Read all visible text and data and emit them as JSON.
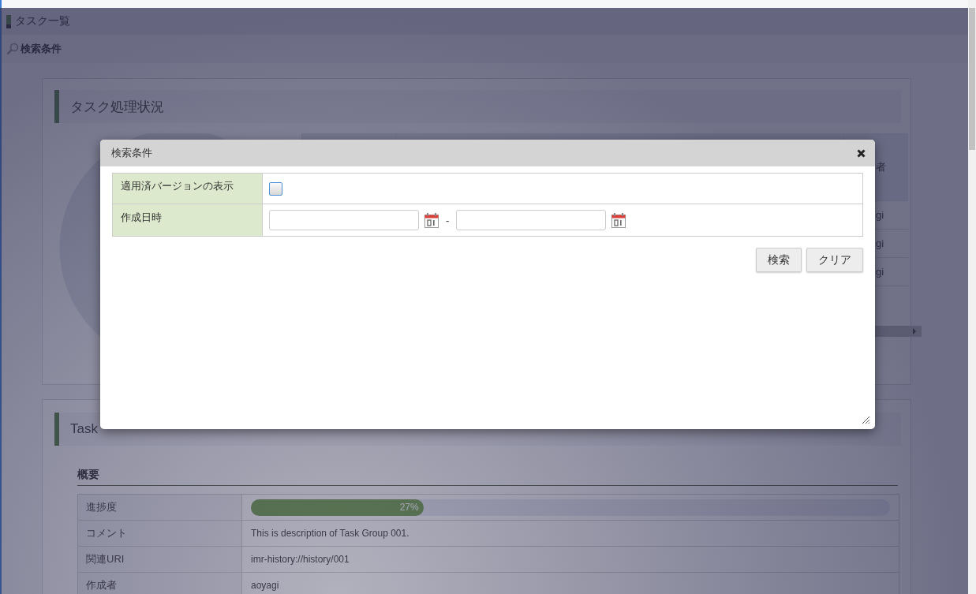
{
  "header": {
    "title": "タスク一覧"
  },
  "search_bar": {
    "label": "検索条件"
  },
  "status_panel": {
    "title": "タスク処理状況",
    "table": {
      "columns": [
        "者"
      ],
      "rows": [
        [
          "gi"
        ],
        [
          "gi"
        ],
        [
          "gi"
        ]
      ]
    }
  },
  "task_group": {
    "title": "Task",
    "section": "概要",
    "rows": [
      {
        "kind": "progress",
        "label": "進捗度",
        "level": 0.27,
        "reading": "27%"
      },
      {
        "kind": "text",
        "label": "コメント",
        "value": "This is description of Task Group 001."
      },
      {
        "kind": "text",
        "label": "関連URI",
        "value": "imr-history://history/001"
      },
      {
        "kind": "text",
        "label": "作成者",
        "value": "aoyagi"
      }
    ]
  },
  "dialog": {
    "title": "検索条件",
    "rows": [
      {
        "kind": "checkbox",
        "label": "適用済バージョンの表示",
        "checked": false
      },
      {
        "kind": "date_range",
        "label": "作成日時",
        "separator": "-"
      }
    ],
    "buttons": [
      "検索",
      "クリア"
    ]
  }
}
